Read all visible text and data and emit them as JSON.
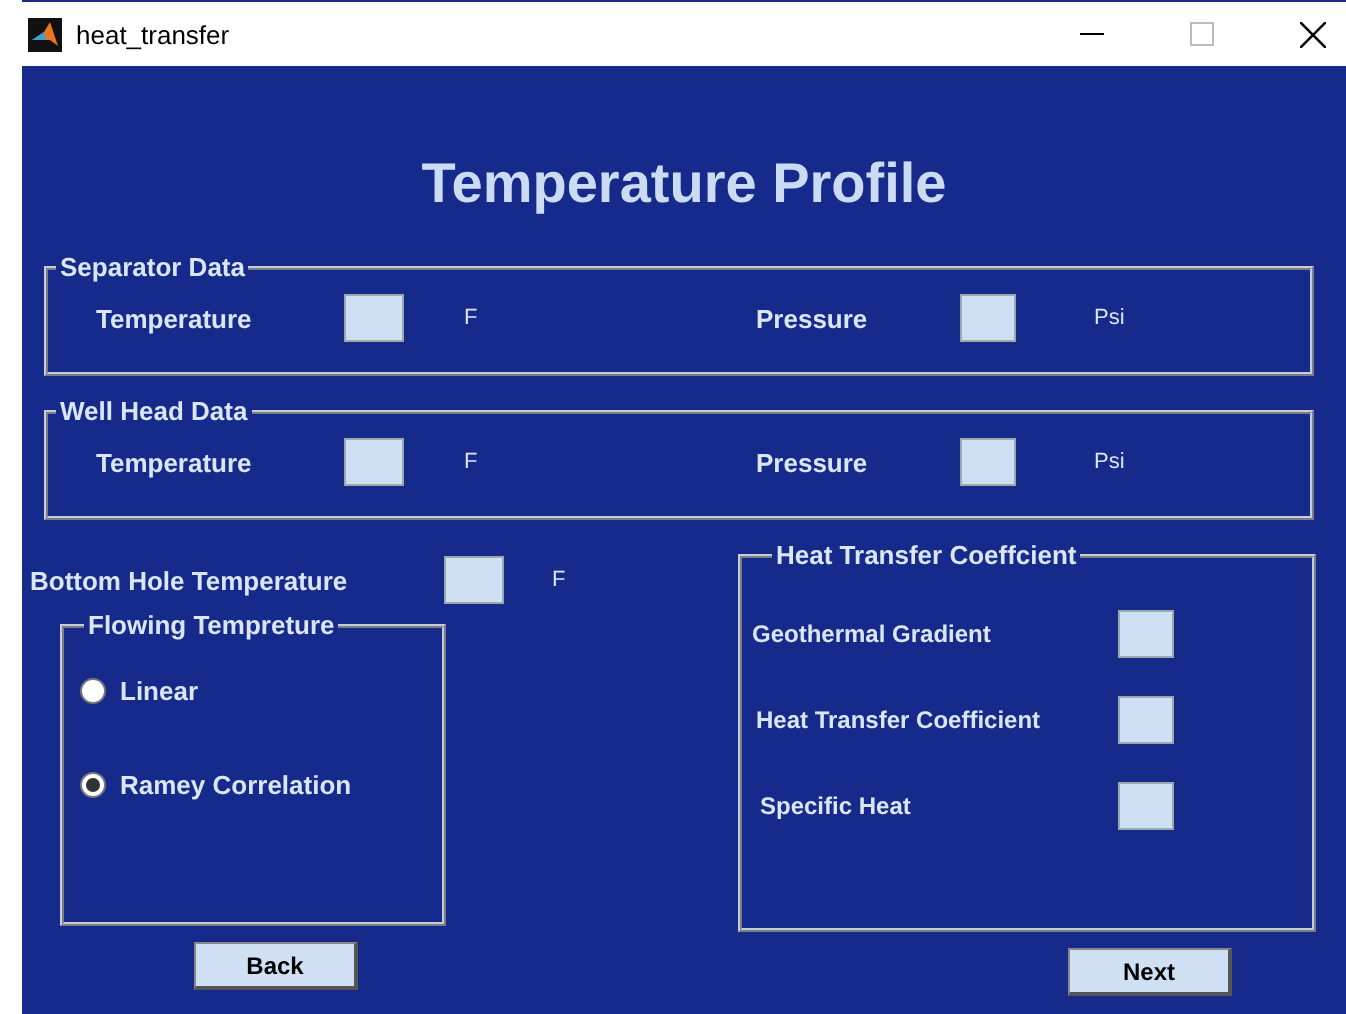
{
  "window": {
    "title": "heat_transfer"
  },
  "heading": "Temperature Profile",
  "groups": [
    {
      "title": "Separator Data",
      "fields": [
        {
          "label": "Temperature",
          "unit": "F"
        },
        {
          "label": "Pressure",
          "unit": "Psi"
        }
      ]
    },
    {
      "title": "Well Head Data",
      "fields": [
        {
          "label": "Temperature",
          "unit": "F"
        },
        {
          "label": "Pressure",
          "unit": "Psi"
        }
      ]
    }
  ],
  "bottom_hole": {
    "label": "Bottom Hole Temperature",
    "unit": "F"
  },
  "flowing": {
    "title": "Flowing Tempreture",
    "options": [
      {
        "label": "Linear",
        "selected": false
      },
      {
        "label": "Ramey Correlation",
        "selected": true
      }
    ]
  },
  "heat_transfer": {
    "title": "Heat Transfer Coeffcient",
    "fields": [
      {
        "label": "Geothermal Gradient"
      },
      {
        "label": "Heat Transfer Coefficient"
      },
      {
        "label": "Specific Heat"
      }
    ]
  },
  "buttons": [
    {
      "label": "Back"
    },
    {
      "label": "Next"
    }
  ]
}
